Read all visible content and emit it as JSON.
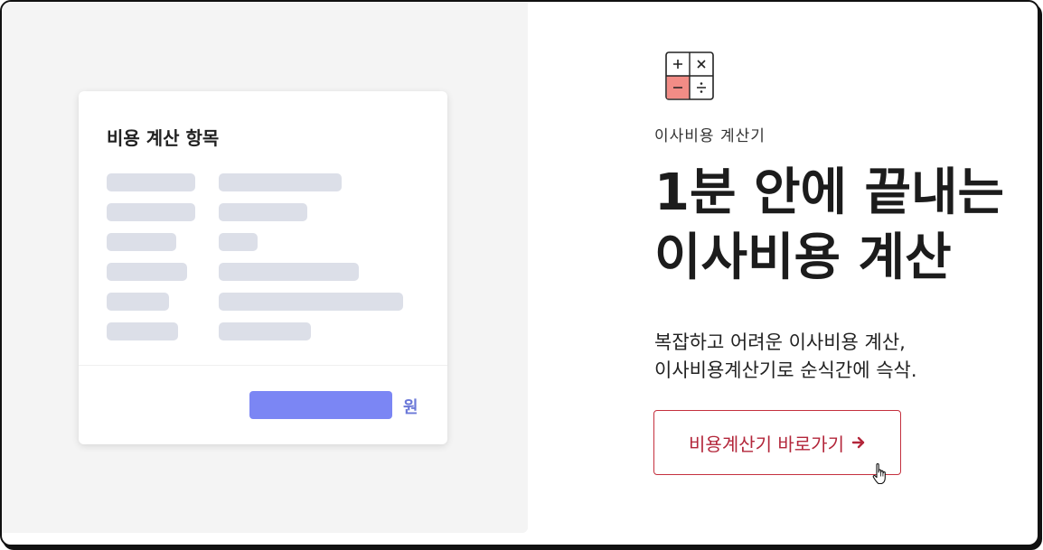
{
  "colors": {
    "panel_bg": "#f4f4f4",
    "skeleton": "#dcdfe8",
    "total_bar": "#7b86f4",
    "accent_red": "#b3263a",
    "icon_minus_bg": "#f28c86"
  },
  "card": {
    "title": "비용 계산 항목",
    "unit": "원",
    "skeleton_rows": 6
  },
  "hero": {
    "icon": "calculator-icon",
    "eyebrow": "이사비용 계산기",
    "headline_line1": "1분 안에 끝내는",
    "headline_line2": "이사비용 계산",
    "desc_line1": "복잡하고 어려운 이사비용 계산,",
    "desc_line2": "이사비용계산기로 순식간에 슥삭.",
    "cta_label": "비용계산기 바로가기",
    "cta_icon": "arrow-right-icon",
    "cursor_icon": "hand-pointer-icon"
  }
}
